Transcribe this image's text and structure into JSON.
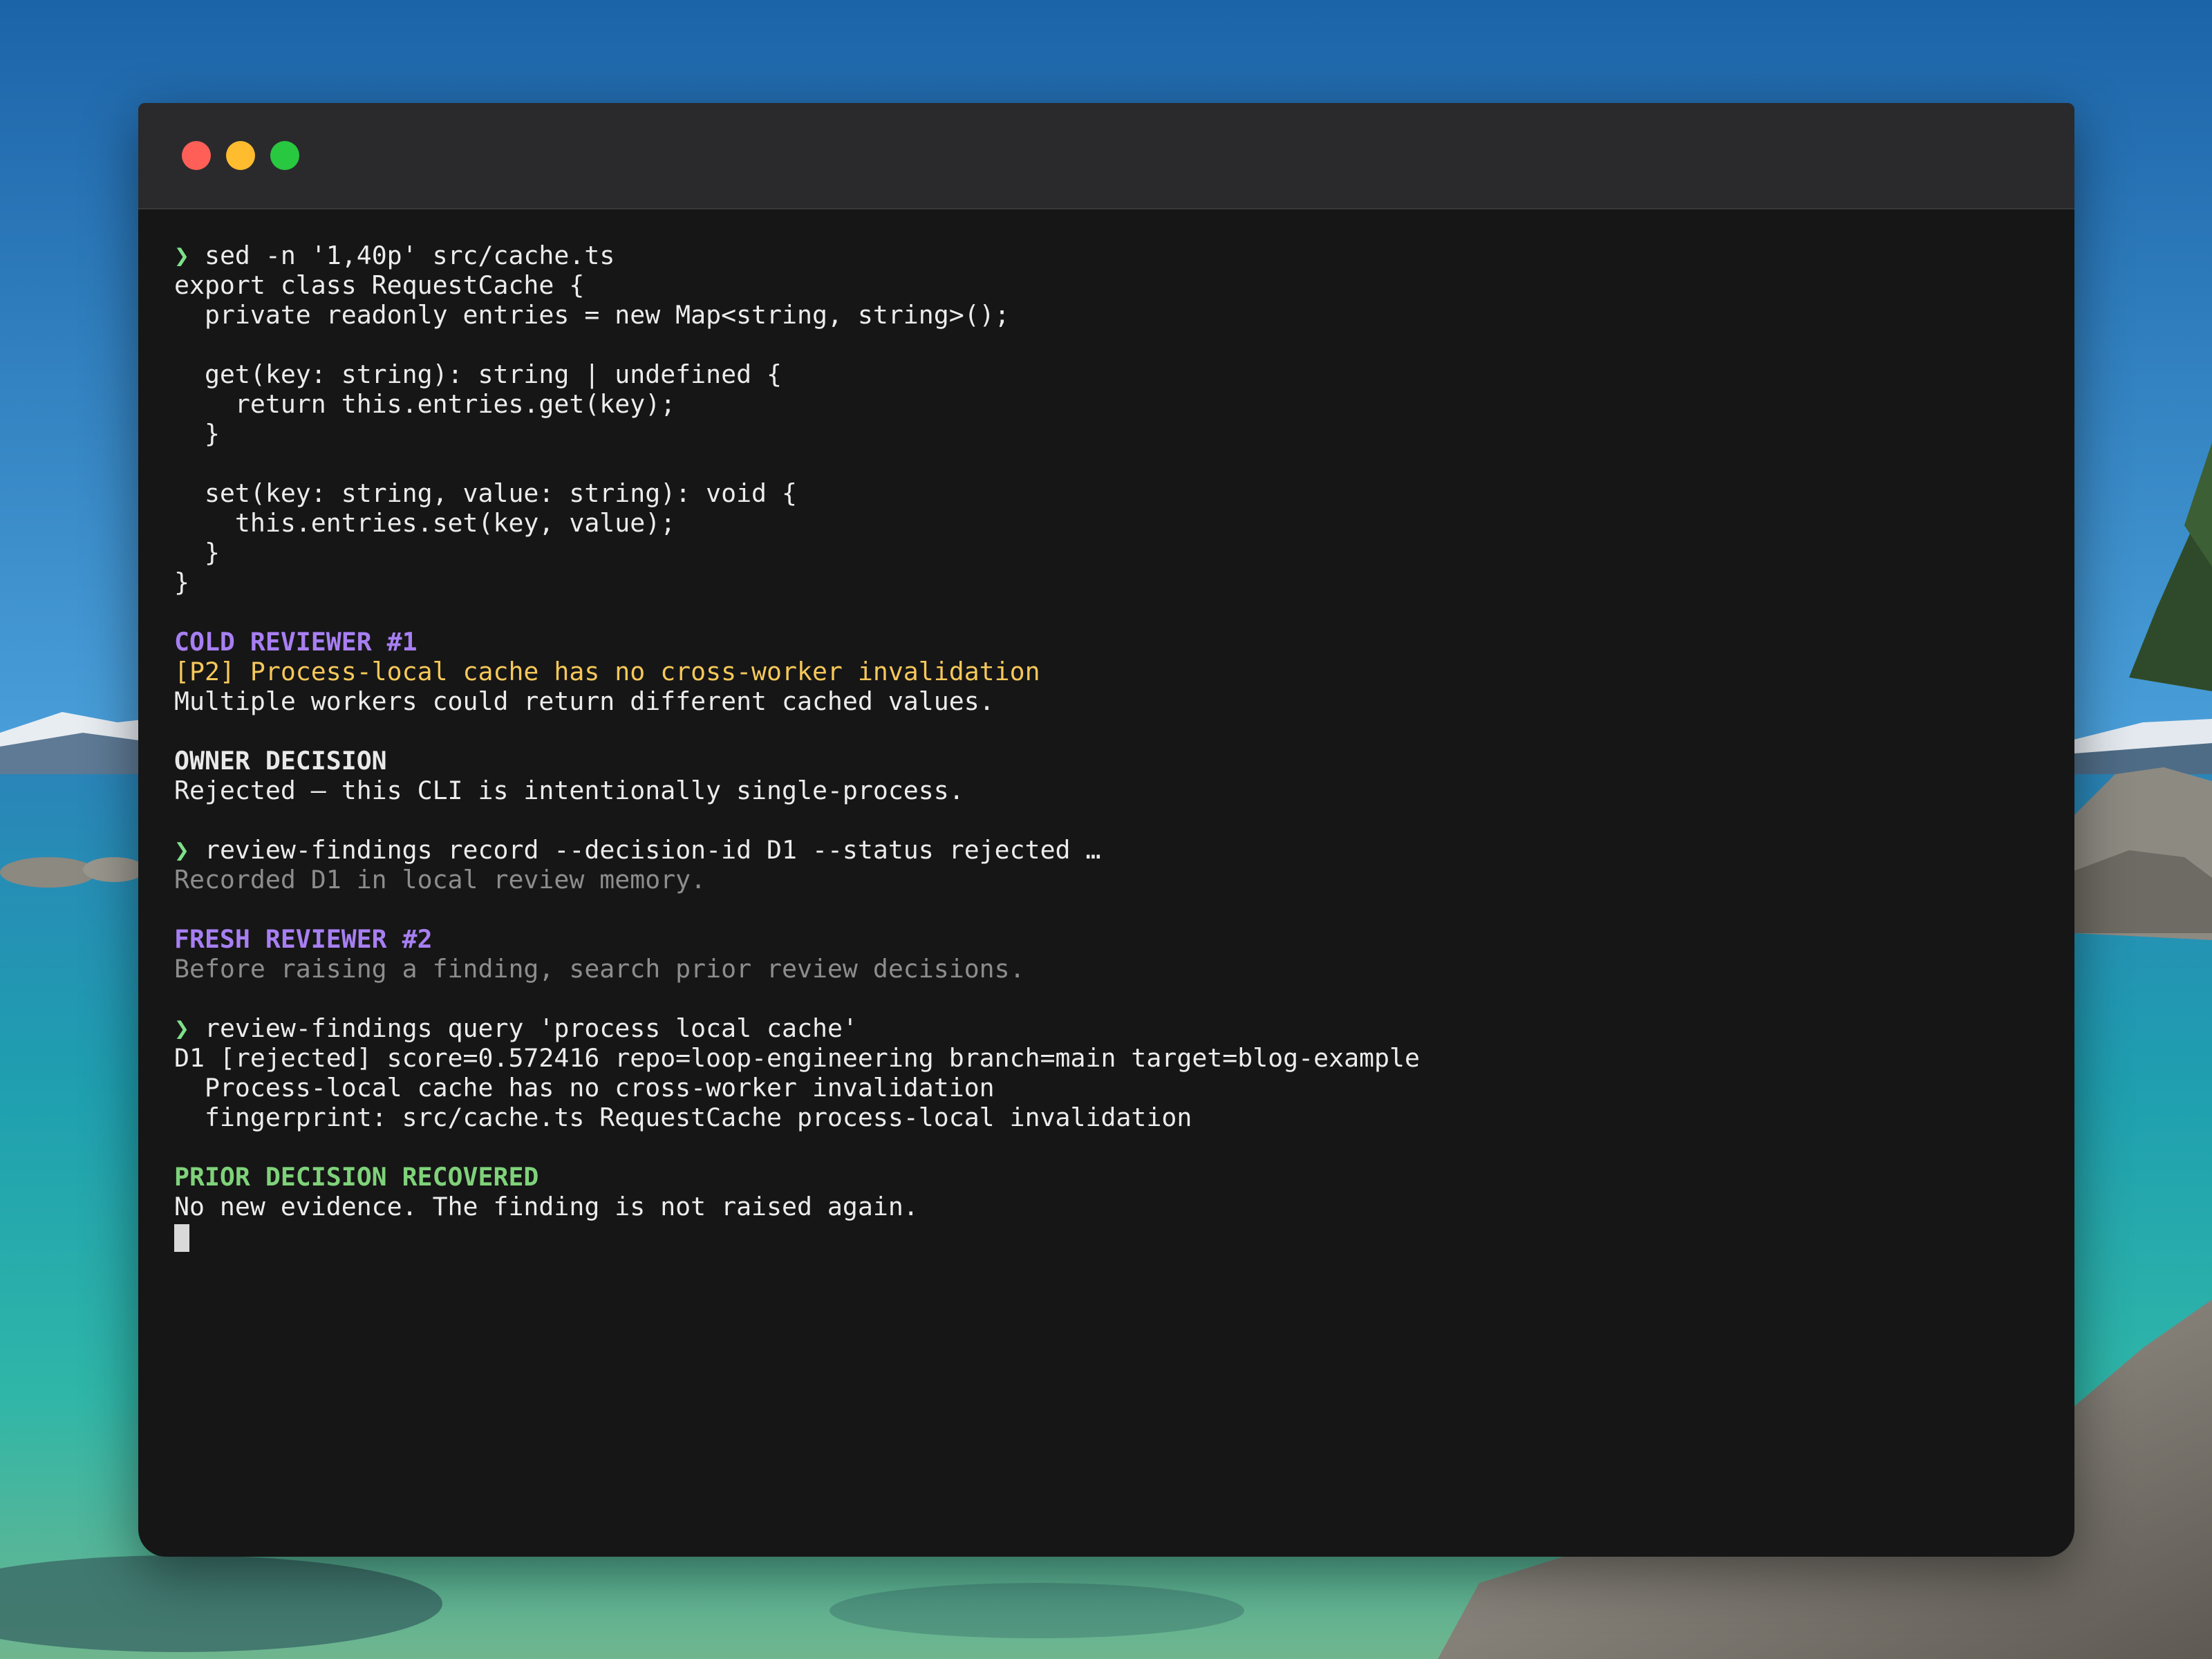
{
  "window": {
    "traffic_lights": [
      "close",
      "minimize",
      "maximize"
    ]
  },
  "terminal": {
    "prompt_symbol": "❯",
    "lines": [
      {
        "kind": "command",
        "text": "sed -n '1,40p' src/cache.ts"
      },
      {
        "kind": "output",
        "text": "export class RequestCache {"
      },
      {
        "kind": "output",
        "text": "  private readonly entries = new Map<string, string>();"
      },
      {
        "kind": "blank",
        "text": ""
      },
      {
        "kind": "output",
        "text": "  get(key: string): string | undefined {"
      },
      {
        "kind": "output",
        "text": "    return this.entries.get(key);"
      },
      {
        "kind": "output",
        "text": "  }"
      },
      {
        "kind": "blank",
        "text": ""
      },
      {
        "kind": "output",
        "text": "  set(key: string, value: string): void {"
      },
      {
        "kind": "output",
        "text": "    this.entries.set(key, value);"
      },
      {
        "kind": "output",
        "text": "  }"
      },
      {
        "kind": "output",
        "text": "}"
      },
      {
        "kind": "blank",
        "text": ""
      },
      {
        "kind": "heading-purple",
        "text": "COLD REVIEWER #1"
      },
      {
        "kind": "warn",
        "text": "[P2] Process-local cache has no cross-worker invalidation"
      },
      {
        "kind": "output",
        "text": "Multiple workers could return different cached values."
      },
      {
        "kind": "blank",
        "text": ""
      },
      {
        "kind": "heading-white",
        "text": "OWNER DECISION"
      },
      {
        "kind": "output",
        "text": "Rejected — this CLI is intentionally single-process."
      },
      {
        "kind": "blank",
        "text": ""
      },
      {
        "kind": "command",
        "text": "review-findings record --decision-id D1 --status rejected …"
      },
      {
        "kind": "dim",
        "text": "Recorded D1 in local review memory."
      },
      {
        "kind": "blank",
        "text": ""
      },
      {
        "kind": "heading-purple",
        "text": "FRESH REVIEWER #2"
      },
      {
        "kind": "dim",
        "text": "Before raising a finding, search prior review decisions."
      },
      {
        "kind": "blank",
        "text": ""
      },
      {
        "kind": "command",
        "text": "review-findings query 'process local cache'"
      },
      {
        "kind": "output",
        "text": "D1 [rejected] score=0.572416 repo=loop-engineering branch=main target=blog-example"
      },
      {
        "kind": "output",
        "text": "  Process-local cache has no cross-worker invalidation"
      },
      {
        "kind": "output",
        "text": "  fingerprint: src/cache.ts RequestCache process-local invalidation"
      },
      {
        "kind": "blank",
        "text": ""
      },
      {
        "kind": "heading-green",
        "text": "PRIOR DECISION RECOVERED"
      },
      {
        "kind": "output",
        "text": "No new evidence. The finding is not raised again."
      }
    ]
  },
  "colors": {
    "terminal_bg": "#161616",
    "titlebar_bg": "#2a2a2d",
    "prompt": "#7ee08a",
    "heading_purple": "#a77ff2",
    "heading_green": "#7fd27a",
    "warning": "#f6c85a",
    "dim_text": "#8d8d8d"
  }
}
